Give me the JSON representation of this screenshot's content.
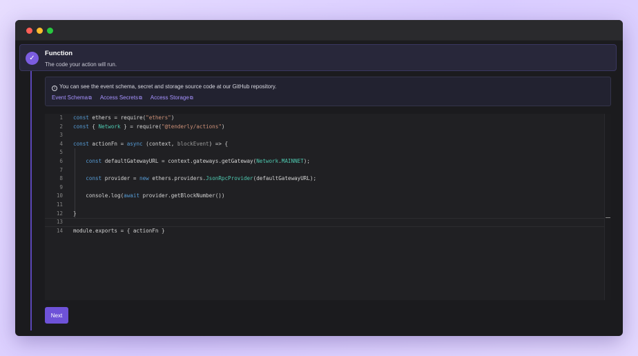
{
  "window": {
    "controls": [
      "close",
      "minimize",
      "maximize"
    ]
  },
  "step": {
    "title": "Function",
    "subtitle": "The code your action will run.",
    "status_icon": "check-icon"
  },
  "info": {
    "text": "You can see the event schema, secret and storage source code at our GitHub repository.",
    "links": [
      {
        "label": "Event Schema"
      },
      {
        "label": "Access Secrets"
      },
      {
        "label": "Access Storage"
      }
    ]
  },
  "editor": {
    "line_numbers": [
      "1",
      "2",
      "3",
      "4",
      "5",
      "6",
      "7",
      "8",
      "9",
      "10",
      "11",
      "12",
      "13",
      "14"
    ],
    "current_line": 13
  },
  "actions": {
    "next_label": "Next"
  },
  "colors": {
    "accent": "#6e52d8",
    "link": "#a692ff",
    "keyword": "#569cd6",
    "string": "#ce9178",
    "class": "#4ec9b0"
  }
}
